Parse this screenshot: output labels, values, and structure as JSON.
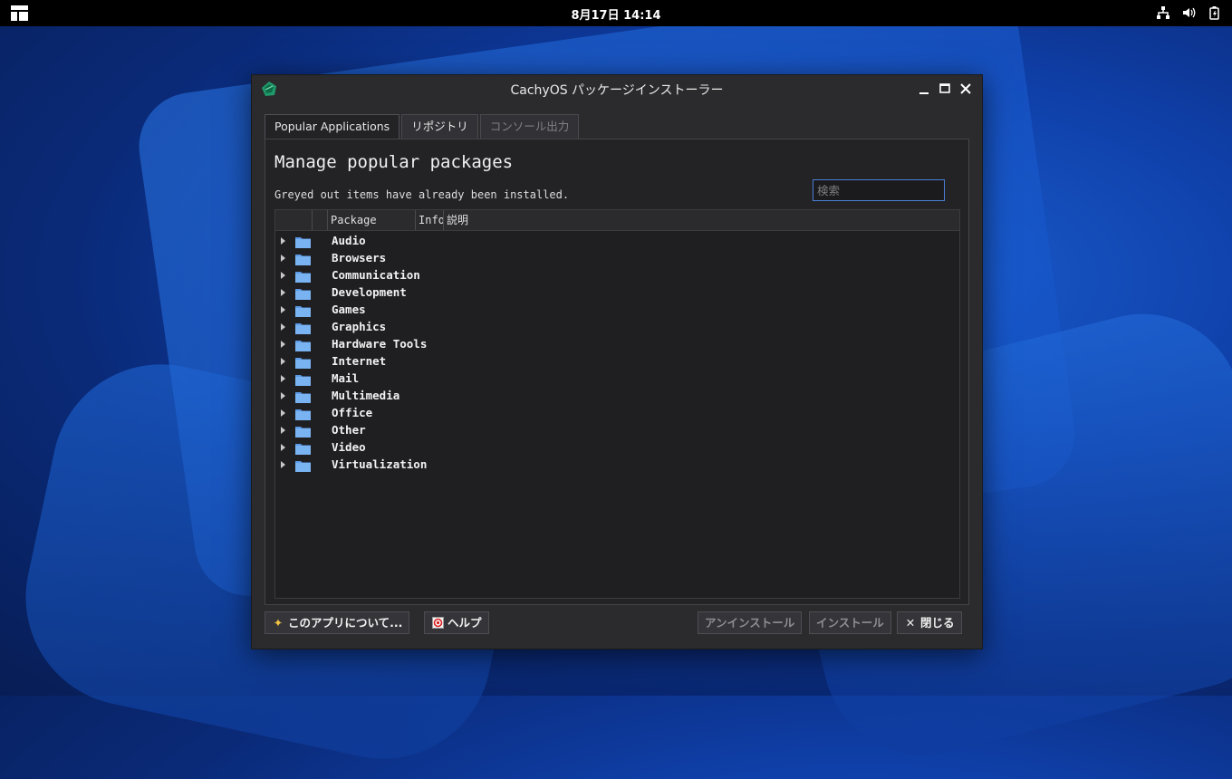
{
  "topbar": {
    "clock": "8月17日 14:14"
  },
  "window": {
    "title": "CachyOS パッケージインストーラー",
    "controls": {
      "minimize": "−",
      "maximize": "□",
      "close": "✕"
    }
  },
  "tabs": [
    {
      "label": "Popular Applications",
      "state": "active"
    },
    {
      "label": "リポジトリ",
      "state": "normal"
    },
    {
      "label": "コンソール出力",
      "state": "disabled"
    }
  ],
  "main": {
    "heading": "Manage popular packages",
    "subtext": "Greyed out items have already been installed.",
    "search_placeholder": "検索",
    "columns": [
      "Package",
      "Info",
      "説明"
    ],
    "categories": [
      "Audio",
      "Browsers",
      "Communication",
      "Development",
      "Games",
      "Graphics",
      "Hardware Tools",
      "Internet",
      "Mail",
      "Multimedia",
      "Office",
      "Other",
      "Video",
      "Virtualization"
    ]
  },
  "footer": {
    "about": "このアプリについて...",
    "help": "ヘルプ",
    "uninstall": "アンインストール",
    "install": "インストール",
    "close": "閉じる"
  },
  "colors": {
    "accent": "#4a7fd6",
    "folder": "#6aa8f0",
    "window_bg": "#2b2b2e",
    "panel_bg": "#232326"
  }
}
